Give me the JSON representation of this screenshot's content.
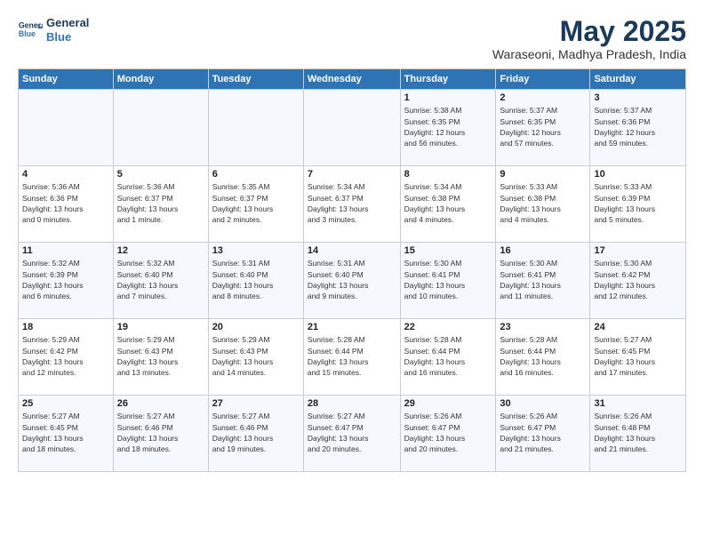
{
  "logo": {
    "line1": "General",
    "line2": "Blue"
  },
  "title": "May 2025",
  "subtitle": "Waraseoni, Madhya Pradesh, India",
  "weekdays": [
    "Sunday",
    "Monday",
    "Tuesday",
    "Wednesday",
    "Thursday",
    "Friday",
    "Saturday"
  ],
  "weeks": [
    [
      {
        "day": "",
        "info": ""
      },
      {
        "day": "",
        "info": ""
      },
      {
        "day": "",
        "info": ""
      },
      {
        "day": "",
        "info": ""
      },
      {
        "day": "1",
        "info": "Sunrise: 5:38 AM\nSunset: 6:35 PM\nDaylight: 12 hours\nand 56 minutes."
      },
      {
        "day": "2",
        "info": "Sunrise: 5:37 AM\nSunset: 6:35 PM\nDaylight: 12 hours\nand 57 minutes."
      },
      {
        "day": "3",
        "info": "Sunrise: 5:37 AM\nSunset: 6:36 PM\nDaylight: 12 hours\nand 59 minutes."
      }
    ],
    [
      {
        "day": "4",
        "info": "Sunrise: 5:36 AM\nSunset: 6:36 PM\nDaylight: 13 hours\nand 0 minutes."
      },
      {
        "day": "5",
        "info": "Sunrise: 5:36 AM\nSunset: 6:37 PM\nDaylight: 13 hours\nand 1 minute."
      },
      {
        "day": "6",
        "info": "Sunrise: 5:35 AM\nSunset: 6:37 PM\nDaylight: 13 hours\nand 2 minutes."
      },
      {
        "day": "7",
        "info": "Sunrise: 5:34 AM\nSunset: 6:37 PM\nDaylight: 13 hours\nand 3 minutes."
      },
      {
        "day": "8",
        "info": "Sunrise: 5:34 AM\nSunset: 6:38 PM\nDaylight: 13 hours\nand 4 minutes."
      },
      {
        "day": "9",
        "info": "Sunrise: 5:33 AM\nSunset: 6:38 PM\nDaylight: 13 hours\nand 4 minutes."
      },
      {
        "day": "10",
        "info": "Sunrise: 5:33 AM\nSunset: 6:39 PM\nDaylight: 13 hours\nand 5 minutes."
      }
    ],
    [
      {
        "day": "11",
        "info": "Sunrise: 5:32 AM\nSunset: 6:39 PM\nDaylight: 13 hours\nand 6 minutes."
      },
      {
        "day": "12",
        "info": "Sunrise: 5:32 AM\nSunset: 6:40 PM\nDaylight: 13 hours\nand 7 minutes."
      },
      {
        "day": "13",
        "info": "Sunrise: 5:31 AM\nSunset: 6:40 PM\nDaylight: 13 hours\nand 8 minutes."
      },
      {
        "day": "14",
        "info": "Sunrise: 5:31 AM\nSunset: 6:40 PM\nDaylight: 13 hours\nand 9 minutes."
      },
      {
        "day": "15",
        "info": "Sunrise: 5:30 AM\nSunset: 6:41 PM\nDaylight: 13 hours\nand 10 minutes."
      },
      {
        "day": "16",
        "info": "Sunrise: 5:30 AM\nSunset: 6:41 PM\nDaylight: 13 hours\nand 11 minutes."
      },
      {
        "day": "17",
        "info": "Sunrise: 5:30 AM\nSunset: 6:42 PM\nDaylight: 13 hours\nand 12 minutes."
      }
    ],
    [
      {
        "day": "18",
        "info": "Sunrise: 5:29 AM\nSunset: 6:42 PM\nDaylight: 13 hours\nand 12 minutes."
      },
      {
        "day": "19",
        "info": "Sunrise: 5:29 AM\nSunset: 6:43 PM\nDaylight: 13 hours\nand 13 minutes."
      },
      {
        "day": "20",
        "info": "Sunrise: 5:29 AM\nSunset: 6:43 PM\nDaylight: 13 hours\nand 14 minutes."
      },
      {
        "day": "21",
        "info": "Sunrise: 5:28 AM\nSunset: 6:44 PM\nDaylight: 13 hours\nand 15 minutes."
      },
      {
        "day": "22",
        "info": "Sunrise: 5:28 AM\nSunset: 6:44 PM\nDaylight: 13 hours\nand 16 minutes."
      },
      {
        "day": "23",
        "info": "Sunrise: 5:28 AM\nSunset: 6:44 PM\nDaylight: 13 hours\nand 16 minutes."
      },
      {
        "day": "24",
        "info": "Sunrise: 5:27 AM\nSunset: 6:45 PM\nDaylight: 13 hours\nand 17 minutes."
      }
    ],
    [
      {
        "day": "25",
        "info": "Sunrise: 5:27 AM\nSunset: 6:45 PM\nDaylight: 13 hours\nand 18 minutes."
      },
      {
        "day": "26",
        "info": "Sunrise: 5:27 AM\nSunset: 6:46 PM\nDaylight: 13 hours\nand 18 minutes."
      },
      {
        "day": "27",
        "info": "Sunrise: 5:27 AM\nSunset: 6:46 PM\nDaylight: 13 hours\nand 19 minutes."
      },
      {
        "day": "28",
        "info": "Sunrise: 5:27 AM\nSunset: 6:47 PM\nDaylight: 13 hours\nand 20 minutes."
      },
      {
        "day": "29",
        "info": "Sunrise: 5:26 AM\nSunset: 6:47 PM\nDaylight: 13 hours\nand 20 minutes."
      },
      {
        "day": "30",
        "info": "Sunrise: 5:26 AM\nSunset: 6:47 PM\nDaylight: 13 hours\nand 21 minutes."
      },
      {
        "day": "31",
        "info": "Sunrise: 5:26 AM\nSunset: 6:48 PM\nDaylight: 13 hours\nand 21 minutes."
      }
    ]
  ]
}
